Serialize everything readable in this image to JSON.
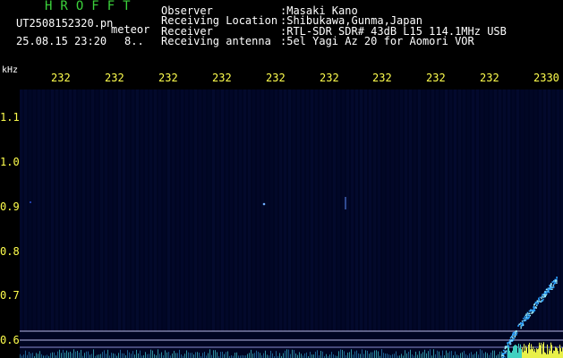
{
  "header": {
    "brand": "HROFFT",
    "file_name": "UT2508152320.pn",
    "mode": "meteor",
    "datetime": "25.08.15 23:20",
    "count": "8..",
    "info": [
      {
        "label": "Observer",
        "value": ":Masaki Kano"
      },
      {
        "label": "Receiving Location",
        "value": ":Shibukawa,Gunma,Japan"
      },
      {
        "label": "Receiver",
        "value": ":RTL-SDR SDR# 43dB L15 114.1MHz USB"
      },
      {
        "label": "Receiving antenna",
        "value": ":5el Yagi Az 20 for Aomori VOR"
      }
    ]
  },
  "axis": {
    "unit": "kHz",
    "time_ticks": [
      "232",
      "232",
      "232",
      "232",
      "232",
      "232",
      "232",
      "232",
      "232",
      "2330"
    ],
    "freq_ticks": [
      "1.1",
      "1.0",
      "0.9",
      "0.8",
      "0.7",
      "0.6"
    ]
  },
  "colors": {
    "background": "#000000",
    "spectrogram_bg": "#000522",
    "label_yellow": "#ffff4d",
    "brand_green": "#3bd23b",
    "trace_cyan": "#2aa0ff"
  }
}
